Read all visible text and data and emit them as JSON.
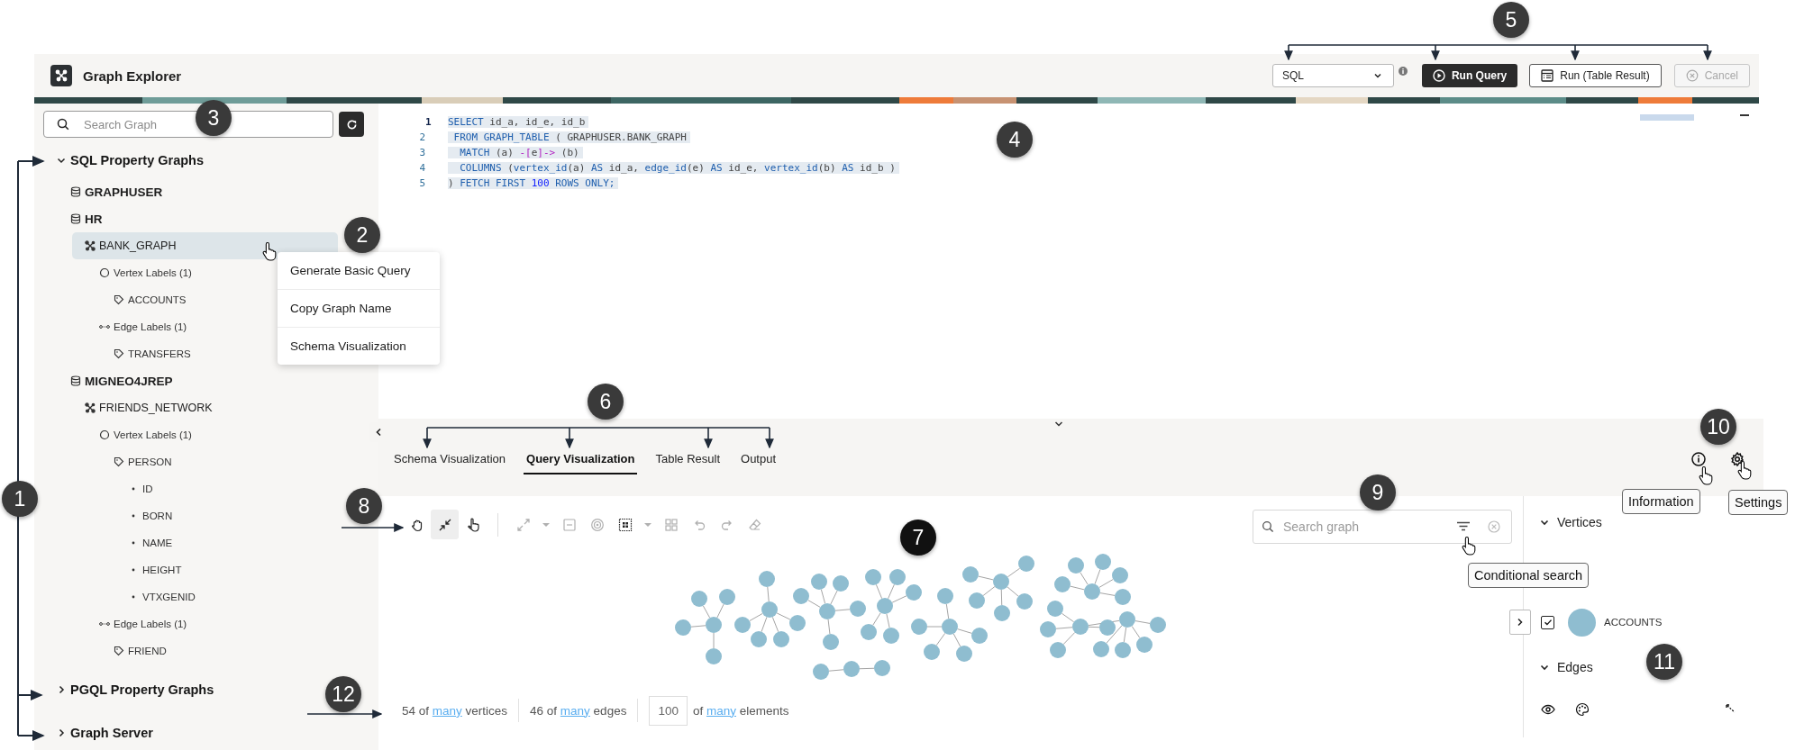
{
  "header": {
    "title": "Graph Explorer",
    "language": "SQL",
    "buttons": [
      {
        "label": "Run Query",
        "kind": "run",
        "disabled": false
      },
      {
        "label": "Run (Table Result)",
        "kind": "table",
        "disabled": false
      },
      {
        "label": "Cancel",
        "kind": "cancel",
        "disabled": true
      }
    ]
  },
  "sidebar": {
    "search": {
      "placeholder": "Search Graph"
    },
    "tree": [
      {
        "label": "SQL Property Graphs",
        "kind": "section",
        "expanded": true,
        "children": [
          {
            "label": "GRAPHUSER",
            "kind": "schema"
          },
          {
            "label": "HR",
            "kind": "schema",
            "children": [
              {
                "label": "BANK_GRAPH",
                "kind": "graph",
                "selected": true,
                "children": [
                  {
                    "label": "Vertex Labels (1)",
                    "kind": "vertex_group",
                    "children": [
                      {
                        "label": "ACCOUNTS",
                        "kind": "label"
                      }
                    ]
                  },
                  {
                    "label": "Edge Labels (1)",
                    "kind": "edge_group",
                    "children": [
                      {
                        "label": "TRANSFERS",
                        "kind": "label"
                      }
                    ]
                  }
                ]
              }
            ]
          },
          {
            "label": "MIGNEO4JREP",
            "kind": "schema",
            "children": [
              {
                "label": "FRIENDS_NETWORK",
                "kind": "graph",
                "selected": false,
                "children": [
                  {
                    "label": "Vertex Labels (1)",
                    "kind": "vertex_group",
                    "children": [
                      {
                        "label": "PERSON",
                        "kind": "label",
                        "children": [
                          {
                            "label": "ID",
                            "kind": "property"
                          },
                          {
                            "label": "BORN",
                            "kind": "property"
                          },
                          {
                            "label": "NAME",
                            "kind": "property"
                          },
                          {
                            "label": "HEIGHT",
                            "kind": "property"
                          },
                          {
                            "label": "VTXGENID",
                            "kind": "property"
                          }
                        ]
                      }
                    ]
                  },
                  {
                    "label": "Edge Labels (1)",
                    "kind": "edge_group",
                    "children": [
                      {
                        "label": "FRIEND",
                        "kind": "label"
                      }
                    ]
                  }
                ]
              }
            ]
          }
        ]
      },
      {
        "label": "PGQL Property Graphs",
        "kind": "section",
        "expanded": false
      },
      {
        "label": "Graph Server",
        "kind": "section",
        "expanded": false
      }
    ]
  },
  "context_menu": {
    "items": [
      "Generate Basic Query",
      "Copy Graph Name",
      "Schema Visualization"
    ]
  },
  "editor": {
    "lines": [
      {
        "number": "1",
        "current": true,
        "tokens": [
          {
            "text": "SELECT",
            "kind": "kw"
          },
          {
            "text": " id_a, id_e, id_b",
            "kind": "id"
          }
        ]
      },
      {
        "number": "2",
        "current": false,
        "tokens": [
          {
            "text": " FROM GRAPH_TABLE",
            "kind": "kw"
          },
          {
            "text": " ( GRAPHUSER.BANK_GRAPH",
            "kind": "id"
          }
        ]
      },
      {
        "number": "3",
        "current": false,
        "tokens": [
          {
            "text": "  MATCH",
            "kind": "kw"
          },
          {
            "text": " (a) ",
            "kind": "id"
          },
          {
            "text": "-[",
            "kind": "op"
          },
          {
            "text": "e",
            "kind": "id"
          },
          {
            "text": "]->",
            "kind": "op"
          },
          {
            "text": " (b)",
            "kind": "id"
          }
        ]
      },
      {
        "number": "4",
        "current": false,
        "tokens": [
          {
            "text": "  COLUMNS",
            "kind": "kw"
          },
          {
            "text": " (",
            "kind": "id"
          },
          {
            "text": "vertex_id",
            "kind": "kw"
          },
          {
            "text": "(a) ",
            "kind": "id"
          },
          {
            "text": "AS",
            "kind": "kw"
          },
          {
            "text": " id_a, ",
            "kind": "id"
          },
          {
            "text": "edge_id",
            "kind": "kw"
          },
          {
            "text": "(e) ",
            "kind": "id"
          },
          {
            "text": "AS",
            "kind": "kw"
          },
          {
            "text": " id_e, ",
            "kind": "id"
          },
          {
            "text": "vertex_id",
            "kind": "kw"
          },
          {
            "text": "(b) ",
            "kind": "id"
          },
          {
            "text": "AS",
            "kind": "kw"
          },
          {
            "text": " id_b )",
            "kind": "id"
          }
        ]
      },
      {
        "number": "5",
        "current": false,
        "tokens": [
          {
            "text": ")",
            "kind": "id"
          },
          {
            "text": " FETCH FIRST ",
            "kind": "kw"
          },
          {
            "text": "100",
            "kind": "num"
          },
          {
            "text": " ROWS ONLY;",
            "kind": "kw"
          }
        ]
      }
    ]
  },
  "tabs": [
    {
      "label": "Schema Visualization",
      "selected": false
    },
    {
      "label": "Query Visualization",
      "selected": true
    },
    {
      "label": "Table Result",
      "selected": false
    },
    {
      "label": "Output",
      "selected": false
    }
  ],
  "toolbar": {
    "tools": [
      {
        "kind": "pan",
        "selected": false
      },
      {
        "kind": "fit",
        "selected": true
      },
      {
        "kind": "select",
        "selected": false
      }
    ],
    "actions": [
      {
        "kind": "expand",
        "disabled": true
      },
      {
        "kind": "dropdown",
        "disabled": true
      },
      {
        "kind": "collapse",
        "disabled": true
      },
      {
        "kind": "focus",
        "disabled": true
      },
      {
        "kind": "layout",
        "disabled": false
      },
      {
        "kind": "dropdown",
        "disabled": true
      },
      {
        "kind": "group",
        "disabled": true
      },
      {
        "kind": "undo",
        "disabled": true
      },
      {
        "kind": "redo",
        "disabled": true
      },
      {
        "kind": "clear",
        "disabled": true
      }
    ]
  },
  "graph_search": {
    "placeholder": "Search graph"
  },
  "footer": [
    {
      "kind": "text",
      "before": "54 of",
      "link": "many",
      "after": "vertices"
    },
    {
      "kind": "text",
      "before": "46 of",
      "link": "many",
      "after": "edges"
    },
    {
      "kind": "input",
      "value": "100",
      "before": "of",
      "link": "many",
      "after": "elements"
    }
  ],
  "legend": {
    "vertices": {
      "title": "Vertices",
      "expanded": true,
      "items": [
        {
          "label": "ACCOUNTS",
          "checked": true,
          "color": "#8fbdd0"
        }
      ]
    },
    "edges": {
      "title": "Edges",
      "expanded": true
    }
  },
  "tooltips": {
    "information": "Information",
    "settings": "Settings",
    "conditional_search": "Conditional search"
  },
  "callouts": [
    "1",
    "2",
    "3",
    "4",
    "5",
    "6",
    "7",
    "8",
    "9",
    "10",
    "11",
    "12"
  ]
}
